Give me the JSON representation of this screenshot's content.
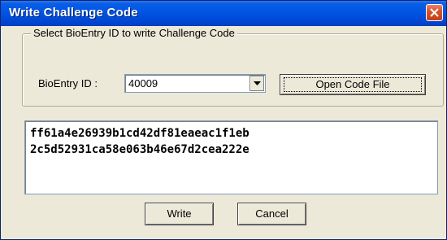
{
  "window": {
    "title": "Write Challenge Code"
  },
  "group": {
    "legend": "Select BioEntry ID to write Challenge Code",
    "bioentry_label": "BioEntry ID :",
    "bioentry_value": "40009",
    "open_button_label": "Open Code File"
  },
  "code": {
    "lines": [
      "ff61a4e26939b1cd42df81eaeac1f1eb",
      "2c5d52931ca58e063b46e67d2cea222e"
    ]
  },
  "buttons": {
    "write_label": "Write",
    "cancel_label": "Cancel"
  },
  "icons": {
    "close": "close-icon",
    "dropdown": "chevron-down-icon"
  },
  "colors": {
    "titlebar": "#0055e4",
    "close_button": "#d8542e",
    "dialog_background": "#ece9d8"
  }
}
